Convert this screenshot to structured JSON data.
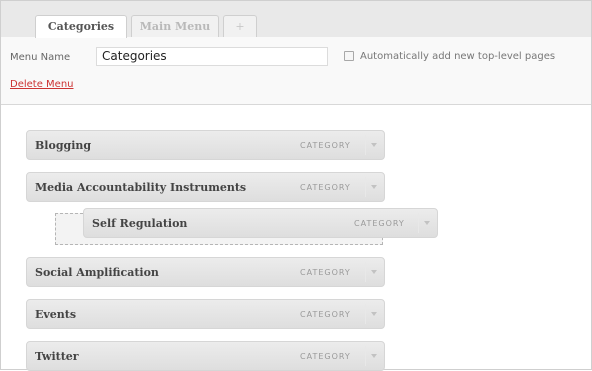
{
  "tabs": [
    {
      "label": "Categories"
    },
    {
      "label": "Main Menu"
    },
    {
      "label": "+"
    }
  ],
  "menu_name": {
    "label": "Menu Name",
    "value": "Categories"
  },
  "auto_add": {
    "label": "Automatically add new top-level pages",
    "checked": false
  },
  "delete_menu": {
    "label": "Delete Menu"
  },
  "items": [
    {
      "title": "Blogging",
      "type": "CATEGORY"
    },
    {
      "title": "Media Accountability Instruments",
      "type": "CATEGORY"
    },
    {
      "title": "Self Regulation",
      "type": "CATEGORY"
    },
    {
      "title": "Social Amplification",
      "type": "CATEGORY"
    },
    {
      "title": "Events",
      "type": "CATEGORY"
    },
    {
      "title": "Twitter",
      "type": "CATEGORY"
    }
  ],
  "icons": {
    "dropdown": "chevron-down-icon",
    "checkbox": "checkbox-icon"
  }
}
